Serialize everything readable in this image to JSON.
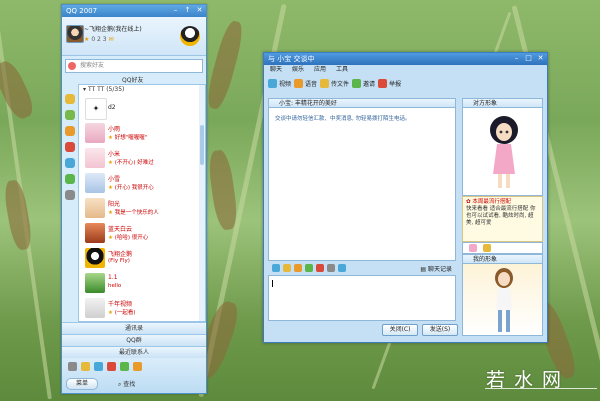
{
  "qq_panel": {
    "title": "QQ 2007",
    "profile": {
      "nickname": "~飞翔企鹅(我在线上)",
      "status": "0 2 3"
    },
    "search_placeholder": "搜索好友",
    "groups": {
      "top": "QQ好友",
      "friends_header": "TT TT (5/35)"
    },
    "friends": [
      {
        "name": "d2",
        "sign": ""
      },
      {
        "name": "小雨",
        "sign": "好想\"喔喔喔\""
      },
      {
        "name": "小米",
        "sign": "(不开心) 好难过"
      },
      {
        "name": "小雪",
        "sign": "(开心) 我很开心"
      },
      {
        "name": "阳光",
        "sign": "我是一个快乐的人"
      },
      {
        "name": "蓝天白云",
        "sign": "(哈哈) 很开心"
      },
      {
        "name": "飞翔企鹅",
        "sign": "(Fly Fly)"
      },
      {
        "name": "1.1",
        "sign": "hello"
      },
      {
        "name": "千年视频",
        "sign": "(一起看)"
      }
    ],
    "sections": {
      "tongxunlu": "通讯录",
      "qq_group": "QQ群",
      "recent": "最近联系人"
    },
    "bottom": {
      "menu": "菜单",
      "find": "查找"
    }
  },
  "chat_window": {
    "title": "与 小宝 交谈中",
    "menu": [
      "聊天",
      "娱乐",
      "应用",
      "工具"
    ],
    "toolbar": [
      {
        "label": "视频",
        "icon": "video-icon"
      },
      {
        "label": "语音",
        "icon": "voice-icon"
      },
      {
        "label": "传文件",
        "icon": "file-icon"
      },
      {
        "label": "邀请",
        "icon": "invite-icon"
      },
      {
        "label": "举报",
        "icon": "report-icon"
      }
    ],
    "conversation_header": "小宝: 丰精花开的美好",
    "system_message": "交谈中请勿轻信汇款、中奖消息, 勿轻易拨打陌生电话。",
    "history_label": "聊天记录",
    "send_buttons": {
      "close": "关闭(C)",
      "send": "发送(S)"
    },
    "side": {
      "my_show_header": "对方形象",
      "tip_title": "本周最流行搭配",
      "tip_text": "快来看看 适合最流行搭配 你也可以试试看, 酷炫时尚, 超美, 超可爱",
      "my_self_header": "我的形象"
    }
  },
  "watermark": "若水网"
}
